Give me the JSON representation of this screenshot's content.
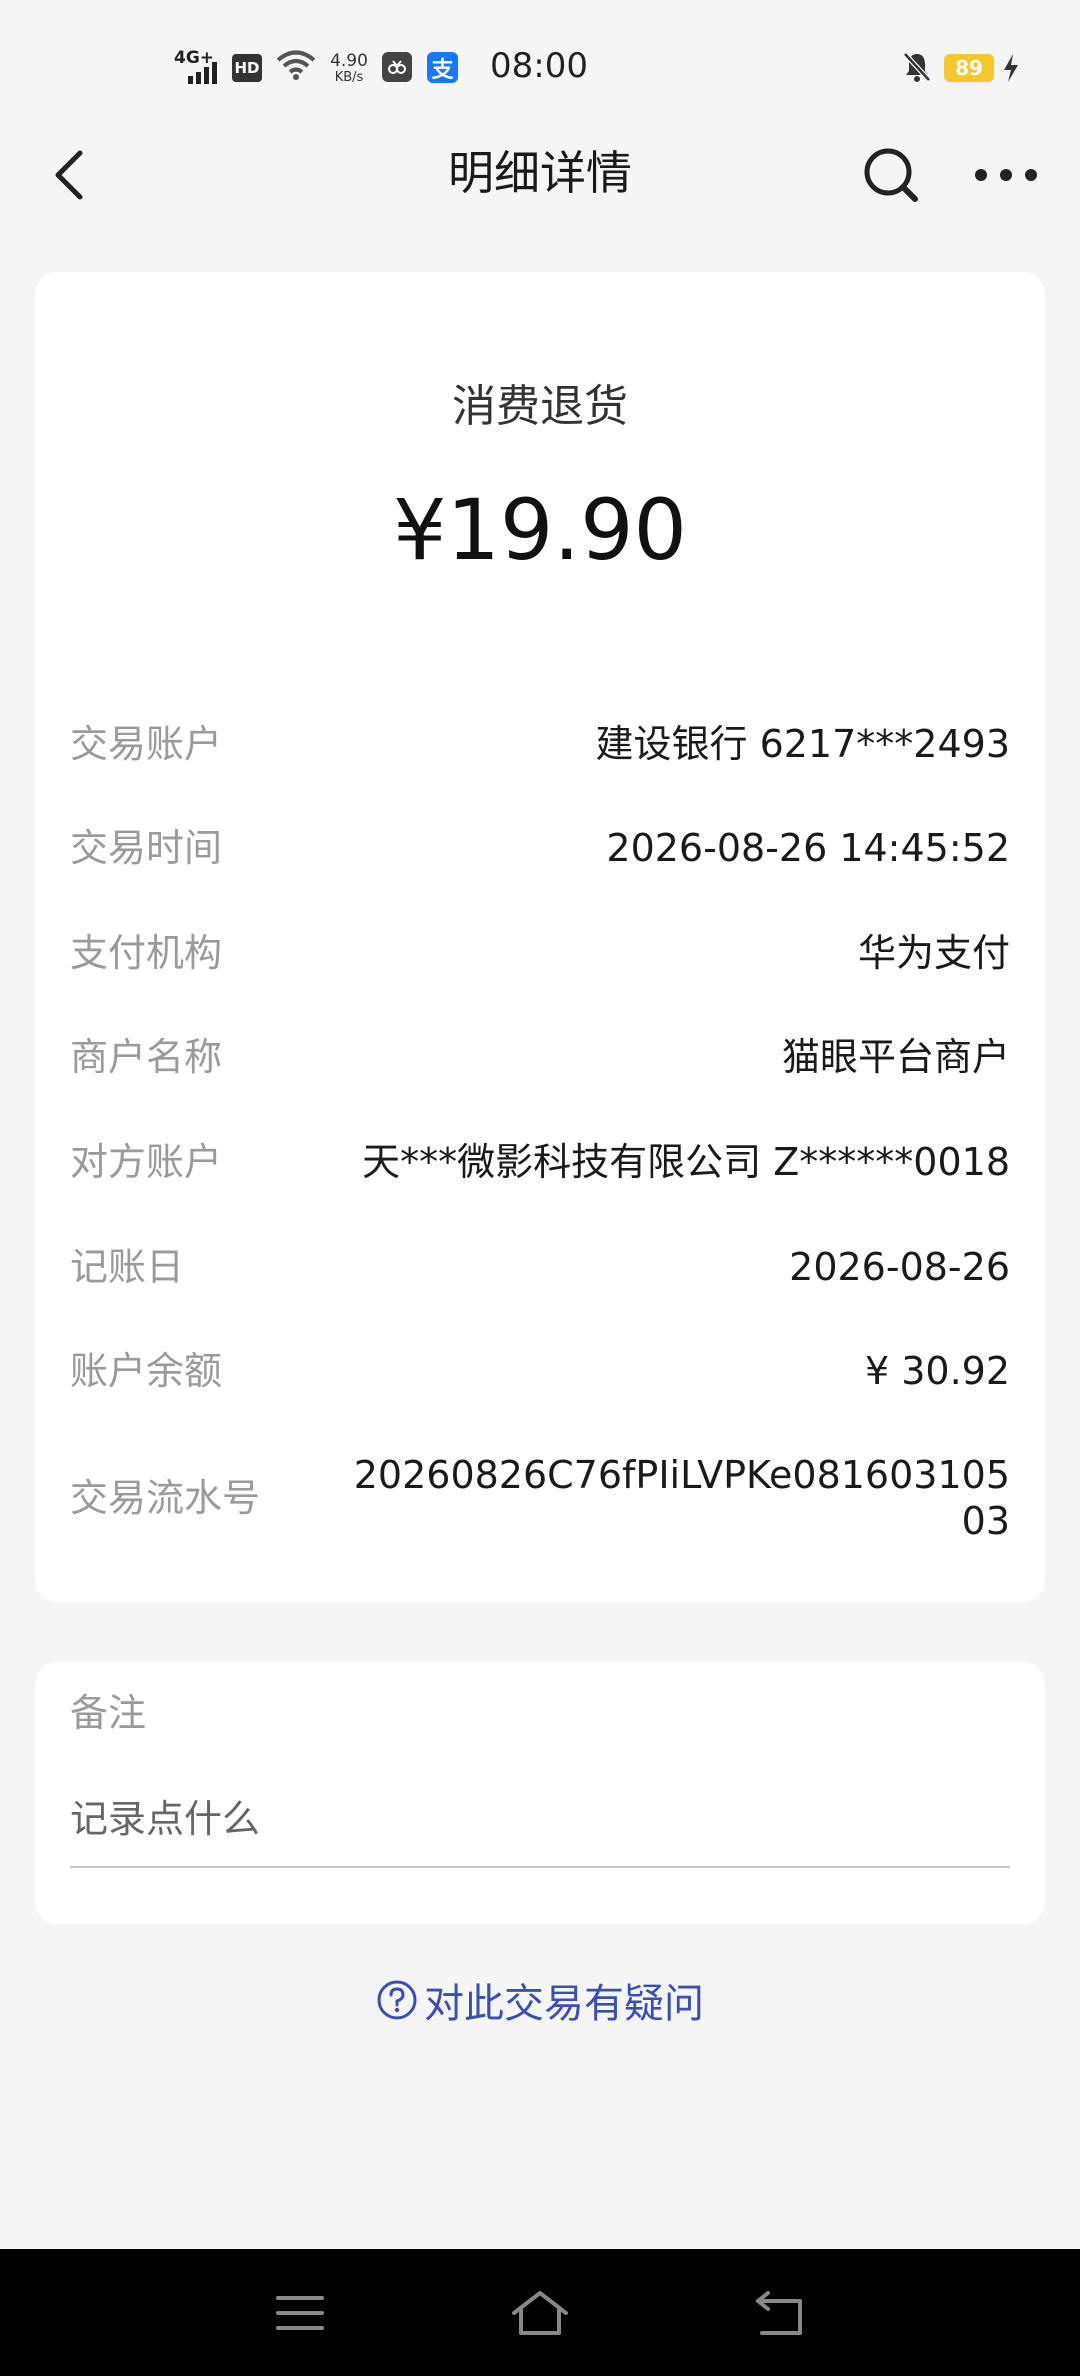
{
  "status_bar": {
    "network": "4G+",
    "hd": "HD",
    "speed_value": "4.90",
    "speed_unit": "KB/s",
    "alipay_glyph": "支",
    "time": "08:00",
    "battery": "89",
    "icons": [
      "signal-icon",
      "wifi-icon",
      "app-icon",
      "alipay-icon",
      "mute-icon",
      "battery-icon",
      "charging-icon"
    ]
  },
  "header": {
    "title": "明细详情",
    "icons": [
      "back-arrow-icon",
      "search-icon",
      "more-icon"
    ]
  },
  "transaction": {
    "type": "消费退货",
    "amount": "¥19.90"
  },
  "details": [
    {
      "label": "交易账户",
      "value": "建设银行 6217***2493"
    },
    {
      "label": "交易时间",
      "value": "2026-08-26 14:45:52"
    },
    {
      "label": "支付机构",
      "value": "华为支付"
    },
    {
      "label": "商户名称",
      "value": "猫眼平台商户"
    },
    {
      "label": "对方账户",
      "value": "天***微影科技有限公司 Z******0018"
    },
    {
      "label": "记账日",
      "value": "2026-08-26"
    },
    {
      "label": "账户余额",
      "value": "¥ 30.92"
    },
    {
      "label": "交易流水号",
      "value": "20260826C76fPIiLVPKe08160310503"
    }
  ],
  "note": {
    "label": "备注",
    "placeholder": "记录点什么"
  },
  "help": {
    "text": "对此交易有疑问",
    "icon": "question-circle-icon"
  },
  "nav_bar": {
    "icons": [
      "menu-icon",
      "home-icon",
      "back-icon"
    ]
  },
  "colors": {
    "background": "#f5f5f5",
    "card": "#ffffff",
    "label": "#9a9a9a",
    "link": "#3a4fb5",
    "battery": "#f4c72c"
  }
}
